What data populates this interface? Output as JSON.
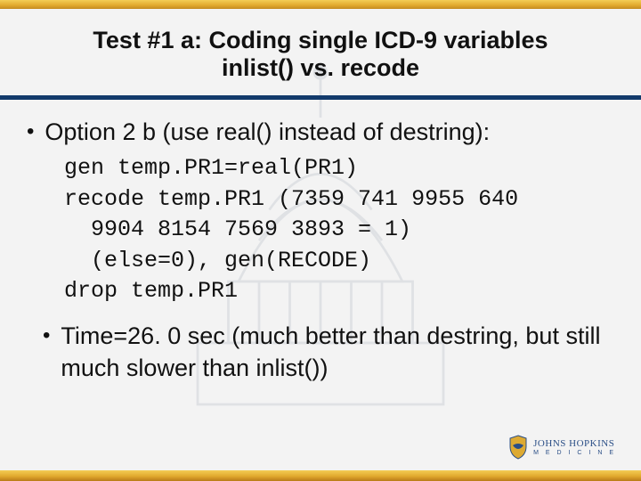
{
  "header": {
    "title_line1": "Test #1 a: Coding single ICD-9 variables",
    "title_line2": "inlist() vs. recode"
  },
  "body": {
    "bullet1": "Option 2 b (use real() instead of destring):",
    "code": "gen temp.PR1=real(PR1)\nrecode temp.PR1 (7359 741 9955 640\n  9904 8154 7569 3893 = 1)\n  (else=0), gen(RECODE)\ndrop temp.PR1",
    "bullet2": "Time=26. 0 sec (much better than destring, but still much slower than inlist())"
  },
  "footer": {
    "logo_main": "JOHNS HOPKINS",
    "logo_sub": "M E D I C I N E"
  },
  "colors": {
    "rule": "#123A6B",
    "gold": "#E1A92D"
  }
}
